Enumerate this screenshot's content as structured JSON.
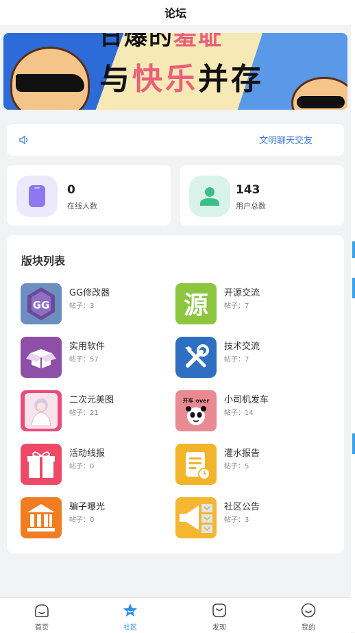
{
  "header": {
    "title": "论坛"
  },
  "banner": {
    "line1_a": "日爆的",
    "line1_b": "羞耻",
    "line2_a": "与",
    "line2_b": "快乐",
    "line2_c": "并存"
  },
  "notice": {
    "icon": "speaker-icon",
    "text": "文明聊天交友"
  },
  "stats": [
    {
      "value": "0",
      "label": "在线人数",
      "icon": "phone-icon",
      "color": "#8e78f0"
    },
    {
      "value": "143",
      "label": "用户总数",
      "icon": "user-icon",
      "color": "#3cbf87"
    }
  ],
  "boards": {
    "title": "版块列表",
    "items": [
      {
        "name": "GG修改器",
        "count": "帖子：3",
        "icon": "gg-icon"
      },
      {
        "name": "开源交流",
        "count": "帖子：7",
        "icon": "source-icon"
      },
      {
        "name": "实用软件",
        "count": "帖子：57",
        "icon": "box-icon"
      },
      {
        "name": "技术交流",
        "count": "帖子：7",
        "icon": "tools-icon"
      },
      {
        "name": "二次元美图",
        "count": "帖子：21",
        "icon": "anime-icon"
      },
      {
        "name": "小司机发车",
        "count": "帖子：14",
        "icon": "driver-icon",
        "badge": "开车 over"
      },
      {
        "name": "活动线报",
        "count": "帖子：0",
        "icon": "gift-icon"
      },
      {
        "name": "灌水报告",
        "count": "帖子：5",
        "icon": "report-icon"
      },
      {
        "name": "骗子曝光",
        "count": "帖子：0",
        "icon": "bank-icon"
      },
      {
        "name": "社区公告",
        "count": "帖子：3",
        "icon": "megaphone-icon"
      }
    ]
  },
  "tabbar": {
    "active": 1,
    "items": [
      {
        "label": "首页",
        "icon": "home-icon"
      },
      {
        "label": "社区",
        "icon": "community-icon"
      },
      {
        "label": "发现",
        "icon": "discover-icon"
      },
      {
        "label": "我的",
        "icon": "profile-icon"
      }
    ]
  },
  "colors": {
    "accent": "#2b8fe8",
    "notice_text": "#3b7bd8"
  }
}
